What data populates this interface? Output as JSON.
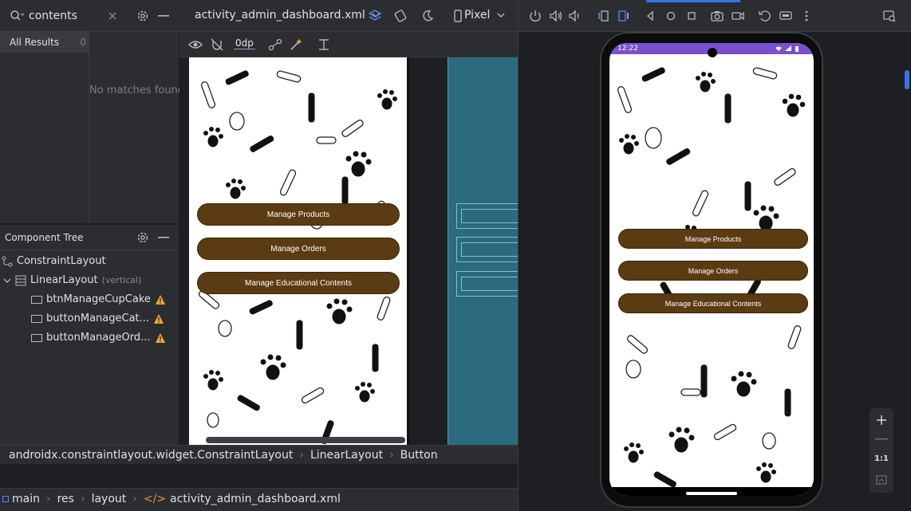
{
  "search": {
    "value": "contents",
    "results_tab": "All Results",
    "results_count": "0",
    "empty_message": "No matches found"
  },
  "component_tree": {
    "title": "Component Tree",
    "items": [
      {
        "label": "ConstraintLayout",
        "note": ""
      },
      {
        "label": "LinearLayout",
        "note": "(vertical)"
      },
      {
        "label": "btnManageCupCake",
        "note": ""
      },
      {
        "label": "buttonManageCat...",
        "note": ""
      },
      {
        "label": "buttonManageOrd...",
        "note": ""
      }
    ]
  },
  "editor": {
    "file_tab": "activity_admin_dashboard.xml",
    "device": "Pixel",
    "dp_value": "0dp"
  },
  "app_buttons": {
    "products": "Manage Products",
    "orders": "Manage Orders",
    "education": "Manage Educational Contents"
  },
  "breadcrumb": [
    "androidx.constraintlayout.widget.ConstraintLayout",
    "LinearLayout",
    "Button"
  ],
  "path": [
    "main",
    "res",
    "layout",
    "activity_admin_dashboard.xml"
  ],
  "emulator": {
    "time": "12:22",
    "zoom_label": "1:1"
  },
  "colors": {
    "button_brown": "#5b3b12",
    "status_purple": "#7b4fd0",
    "blueprint_blue": "#2c6a80",
    "warning_orange": "#f0a732",
    "ide_bg": "#2b2d30"
  }
}
